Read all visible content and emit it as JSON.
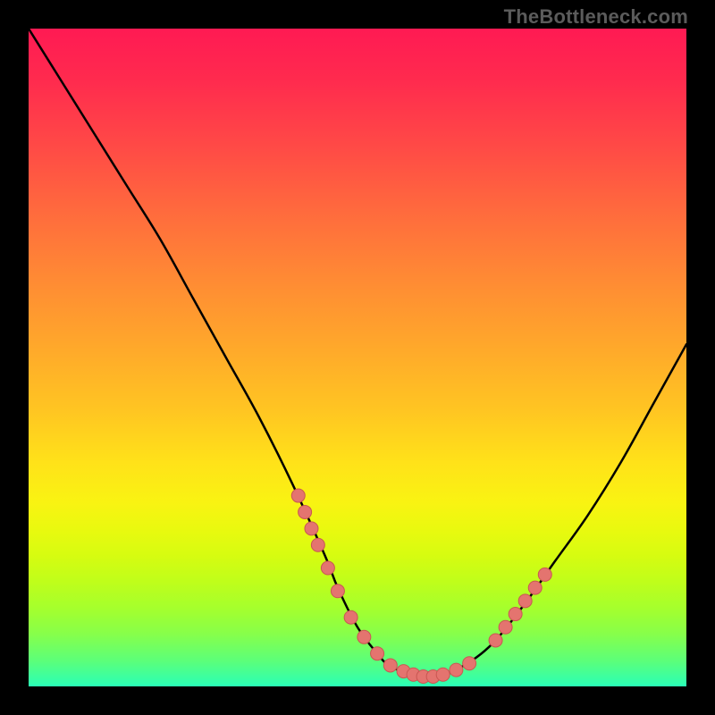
{
  "watermark": "TheBottleneck.com",
  "chart_data": {
    "type": "line",
    "title": "",
    "xlabel": "",
    "ylabel": "",
    "xlim": [
      0,
      100
    ],
    "ylim": [
      0,
      100
    ],
    "series": [
      {
        "name": "curve",
        "x": [
          0,
          5,
          10,
          15,
          20,
          25,
          30,
          35,
          40,
          45,
          47,
          50,
          53,
          55,
          58,
          60,
          62,
          65,
          70,
          75,
          80,
          85,
          90,
          95,
          100
        ],
        "values": [
          100,
          92,
          84,
          76,
          68,
          59,
          50,
          41,
          31,
          20,
          15,
          9,
          5,
          3,
          2,
          1.5,
          1.5,
          2.5,
          6,
          12,
          19,
          26,
          34,
          43,
          52
        ]
      }
    ],
    "markers": [
      {
        "x": 41,
        "y": 29
      },
      {
        "x": 42,
        "y": 26.5
      },
      {
        "x": 43,
        "y": 24
      },
      {
        "x": 44,
        "y": 21.5
      },
      {
        "x": 45.5,
        "y": 18
      },
      {
        "x": 47,
        "y": 14.5
      },
      {
        "x": 49,
        "y": 10.5
      },
      {
        "x": 51,
        "y": 7.5
      },
      {
        "x": 53,
        "y": 5
      },
      {
        "x": 55,
        "y": 3.2
      },
      {
        "x": 57,
        "y": 2.3
      },
      {
        "x": 58.5,
        "y": 1.8
      },
      {
        "x": 60,
        "y": 1.5
      },
      {
        "x": 61.5,
        "y": 1.5
      },
      {
        "x": 63,
        "y": 1.8
      },
      {
        "x": 65,
        "y": 2.5
      },
      {
        "x": 67,
        "y": 3.5
      },
      {
        "x": 71,
        "y": 7
      },
      {
        "x": 72.5,
        "y": 9
      },
      {
        "x": 74,
        "y": 11
      },
      {
        "x": 75.5,
        "y": 13
      },
      {
        "x": 77,
        "y": 15
      },
      {
        "x": 78.5,
        "y": 17
      }
    ],
    "colors": {
      "curve": "#000000",
      "marker_fill": "#e4746f",
      "marker_stroke": "#c95752"
    }
  }
}
